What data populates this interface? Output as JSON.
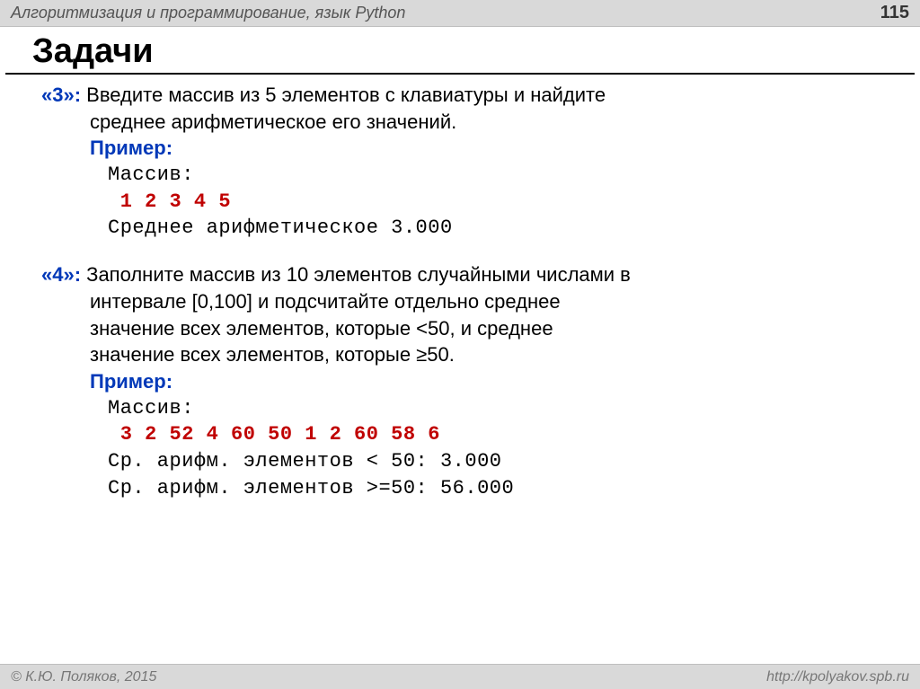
{
  "header": {
    "title": "Алгоритмизация и программирование, язык Python",
    "pageNumber": "115"
  },
  "mainTitle": "Задачи",
  "task3": {
    "label": "«3»:",
    "textLine1": " Введите массив из 5 элементов с клавиатуры и найдите",
    "textLine2": "среднее арифметическое его значений.",
    "exampleLabel": "Пример:",
    "arrayLabel": "Массив:",
    "arrayValues": "1 2 3 4 5",
    "resultLine": "Среднее арифметическое 3.000"
  },
  "task4": {
    "label": "«4»:",
    "textLine1": " Заполните массив из 10 элементов случайными числами в",
    "textLine2": "интервале [0,100] и подсчитайте отдельно среднее",
    "textLine3": "значение всех элементов, которые <50, и среднее",
    "textLine4": "значение всех элементов, которые ≥50.",
    "exampleLabel": "Пример:",
    "arrayLabel": "Массив:",
    "arrayValues": "3 2 52 4 60 50 1 2 60 58 6",
    "resultLine1": "Ср. арифм. элементов < 50: 3.000",
    "resultLine2": "Ср. арифм. элементов >=50: 56.000"
  },
  "footer": {
    "copyright": "© К.Ю. Поляков, 2015",
    "url": "http://kpolyakov.spb.ru"
  }
}
